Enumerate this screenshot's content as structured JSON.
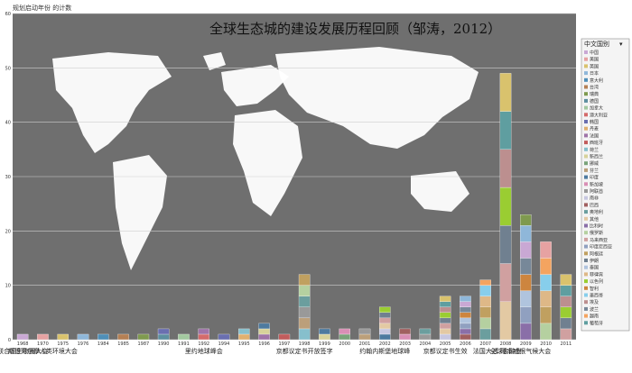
{
  "chart_data": {
    "type": "bar",
    "title": "全球生态城的建设发展历程回顾（邹涛，2012）",
    "ylabel": "规划启动年份 的计数",
    "ylim": [
      0,
      60
    ],
    "yticks": [
      0,
      10,
      20,
      30,
      40,
      50,
      60
    ],
    "grid": true,
    "legend_position": "right",
    "legend_title": "中文国别",
    "legend_items": [
      "中国",
      "美国",
      "英国",
      "日本",
      "意大利",
      "台湾",
      "瑞典",
      "德国",
      "加拿大",
      "澳大利亚",
      "韩国",
      "丹麦",
      "法国",
      "西班牙",
      "荷兰",
      "新西兰",
      "挪威",
      "芬兰",
      "印度",
      "新加坡",
      "阿联酋",
      "南非",
      "巴西",
      "奥地利",
      "其他",
      "比利时",
      "俄罗斯",
      "马来西亚",
      "印度尼西亚",
      "阿根廷",
      "伊朗",
      "泰国",
      "菲律宾",
      "以色列",
      "智利",
      "墨西哥",
      "埃及",
      "波兰",
      "越南",
      "葡萄牙"
    ],
    "legend_colors": [
      "#c9a8d4",
      "#e6a2a2",
      "#d9c26d",
      "#8fb7d9",
      "#4f8fb8",
      "#b58054",
      "#7f9a4f",
      "#5e8fa0",
      "#a3c9a0",
      "#d46b6b",
      "#6a6fb0",
      "#e0b070",
      "#9f74a8",
      "#c25c5c",
      "#86bfcc",
      "#d7d29a",
      "#7aa37a",
      "#bb9f7a",
      "#4d7a9f",
      "#d98fb5",
      "#999999",
      "#c7c7e0",
      "#a06060",
      "#6b9e9e",
      "#e3c9a3",
      "#8a6fa8",
      "#b5d0a0",
      "#d0a0a0",
      "#90a0c0",
      "#c0a060",
      "#708090",
      "#b0c4de",
      "#deb887",
      "#9acd32",
      "#cd853f",
      "#87ceeb",
      "#bc8f8f",
      "#778899",
      "#f4a460",
      "#5f9ea0"
    ],
    "categories": [
      "1968",
      "1970",
      "1975",
      "1976",
      "1984",
      "1985",
      "1987",
      "1990",
      "1991",
      "1992",
      "1994",
      "1995",
      "1996",
      "1997",
      "1998",
      "1999",
      "2000",
      "2001",
      "2002",
      "2003",
      "2004",
      "2005",
      "2006",
      "2007",
      "2008",
      "2009",
      "2010",
      "2011"
    ],
    "values": [
      1,
      1,
      1,
      1,
      1,
      1,
      1,
      2,
      1,
      2,
      1,
      2,
      3,
      1,
      12,
      2,
      2,
      2,
      6,
      2,
      2,
      8,
      8,
      11,
      49,
      23,
      18,
      12
    ],
    "annotations": [
      {
        "text": "联合国生物圈大会",
        "category": "1968"
      },
      {
        "text": "斯德哥尔摩人类环境大会",
        "category": "1970"
      },
      {
        "text": "里约地球峰会",
        "category": "1992"
      },
      {
        "text": "京都议定书开放签字",
        "category": "1998"
      },
      {
        "text": "约翰内斯堡地球峰",
        "category": "2002"
      },
      {
        "text": "京都议定书生效",
        "category": "2005"
      },
      {
        "text": "法国大选",
        "category": "2007"
      },
      {
        "text": "全球金融危",
        "category": "2008"
      },
      {
        "text": "哥本哈根气候大会",
        "category": "2009"
      }
    ]
  }
}
